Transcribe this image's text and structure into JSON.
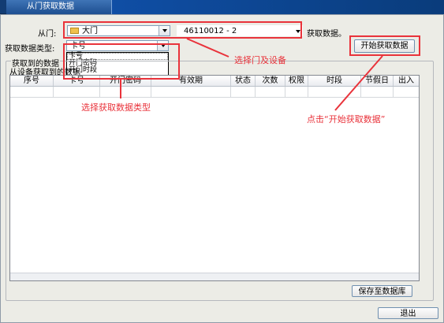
{
  "window": {
    "title": "从门获取数据"
  },
  "door_row": {
    "label": "从门:",
    "door_value": "大门",
    "device_value": "46110012 - 2",
    "trailing_label": "获取数据。"
  },
  "type_row": {
    "label": "获取数据类型:",
    "selected": "卡号",
    "options": [
      "卡号",
      "开门密码",
      "开门时段"
    ]
  },
  "start_button": "开始获取数据",
  "group": {
    "title": "获取到的数据",
    "subtitle": "从设备获取到的数据"
  },
  "table": {
    "columns": [
      "序号",
      "卡号",
      "开门密码",
      "有效期",
      "状态",
      "次数",
      "权限",
      "时段",
      "节假日",
      "出入"
    ]
  },
  "save_button": "保存至数据库",
  "exit_button": "退出",
  "annotations": {
    "select_door": "选择门及设备",
    "select_type": "选择获取数据类型",
    "click_start": "点击“开始获取数据”"
  },
  "colors": {
    "annotation": "#e9333b",
    "titlebar": "#123c73"
  }
}
